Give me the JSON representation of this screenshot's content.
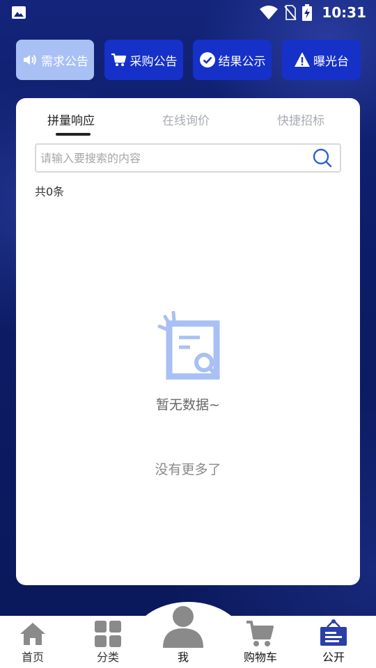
{
  "status_bar": {
    "time": "10:31"
  },
  "top_buttons": [
    {
      "label": "需求公告",
      "icon": "speaker-icon",
      "active": true
    },
    {
      "label": "采购公告",
      "icon": "cart-icon",
      "active": false
    },
    {
      "label": "结果公示",
      "icon": "check-circle-icon",
      "active": false
    },
    {
      "label": "曝光台",
      "icon": "warning-icon",
      "active": false
    }
  ],
  "tabs": [
    {
      "label": "拼量响应",
      "active": true
    },
    {
      "label": "在线询价",
      "active": false
    },
    {
      "label": "快捷招标",
      "active": false
    }
  ],
  "search": {
    "placeholder": "请输入要搜索的内容",
    "value": ""
  },
  "result_count": "共0条",
  "empty_state": {
    "message": "暂无数据~",
    "no_more": "没有更多了"
  },
  "bottom_nav": [
    {
      "label": "首页",
      "icon": "home-icon"
    },
    {
      "label": "分类",
      "icon": "grid-icon"
    },
    {
      "label": "我",
      "icon": "user-icon"
    },
    {
      "label": "购物车",
      "icon": "cart-icon"
    },
    {
      "label": "公开",
      "icon": "notice-board-icon"
    }
  ],
  "colors": {
    "background": "#0d1f6b",
    "button": "#1631c8",
    "button_active": "#a9c0f5",
    "accent": "#3a64d8"
  }
}
